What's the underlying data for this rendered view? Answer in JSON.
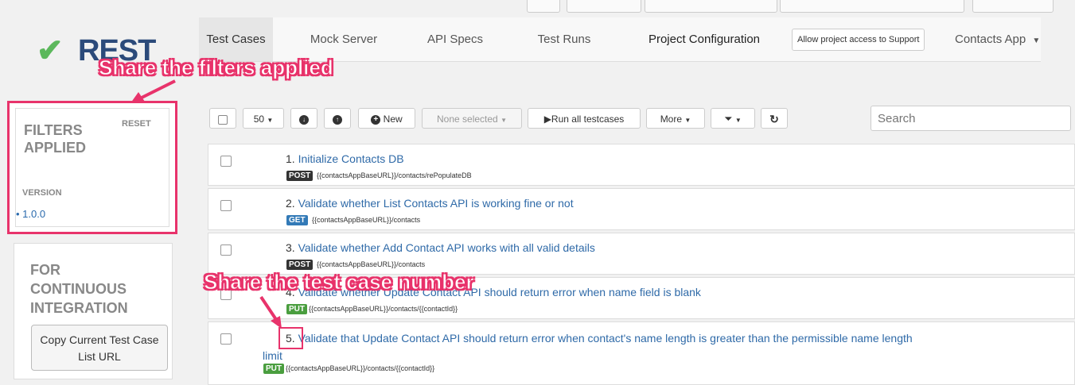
{
  "app": {
    "logo_text": "REST",
    "logo_icon": "checkmark-icon"
  },
  "nav": {
    "tabs": [
      {
        "label": "Test Cases",
        "active": true
      },
      {
        "label": "Mock Server",
        "active": false
      },
      {
        "label": "API Specs",
        "active": false
      },
      {
        "label": "Test Runs",
        "active": false
      },
      {
        "label": "Project Configuration",
        "active": false
      }
    ],
    "support_button": "Allow project access to Support",
    "app_select": "Contacts App"
  },
  "annotations": {
    "filters": "Share the filters applied",
    "test_case_number": "Share the test case number"
  },
  "filters": {
    "title": "FILTERS APPLIED",
    "reset": "RESET",
    "version_label": "VERSION",
    "version_value": "1.0.0"
  },
  "ci": {
    "title": "FOR CONTINUOUS INTEGRATION",
    "copy_button": "Copy Current Test Case List URL"
  },
  "toolbar": {
    "page_size": "50",
    "new_label": "New",
    "selection": "None selected",
    "run_all": "Run all testcases",
    "more": "More",
    "search_placeholder": "Search"
  },
  "testcases": [
    {
      "num": "1.",
      "title": "Initialize Contacts DB",
      "method": "POST",
      "url": "{{contactsAppBaseURL}}/contacts/rePopulateDB"
    },
    {
      "num": "2.",
      "title": "Validate whether List Contacts API is working fine or not",
      "method": "GET",
      "url": "{{contactsAppBaseURL}}/contacts"
    },
    {
      "num": "3.",
      "title": "Validate whether Add Contact API works with all valid details",
      "method": "POST",
      "url": "{{contactsAppBaseURL}}/contacts"
    },
    {
      "num": "4.",
      "title": "Validate whether Update Contact API should return error when name field is blank",
      "method": "PUT",
      "url": "{{contactsAppBaseURL}}/contacts/{{contactId}}"
    },
    {
      "num": "5.",
      "title": "Validate that Update Contact API should return error when contact's name length is greater than the permissible name length",
      "title_wrap": "limit",
      "method": "PUT",
      "url": "{{contactsAppBaseURL}}/contacts/{{contactId}}"
    }
  ],
  "colors": {
    "accent_annotation": "#e8336b",
    "link": "#2f6aa8",
    "success": "#5cb85c"
  }
}
